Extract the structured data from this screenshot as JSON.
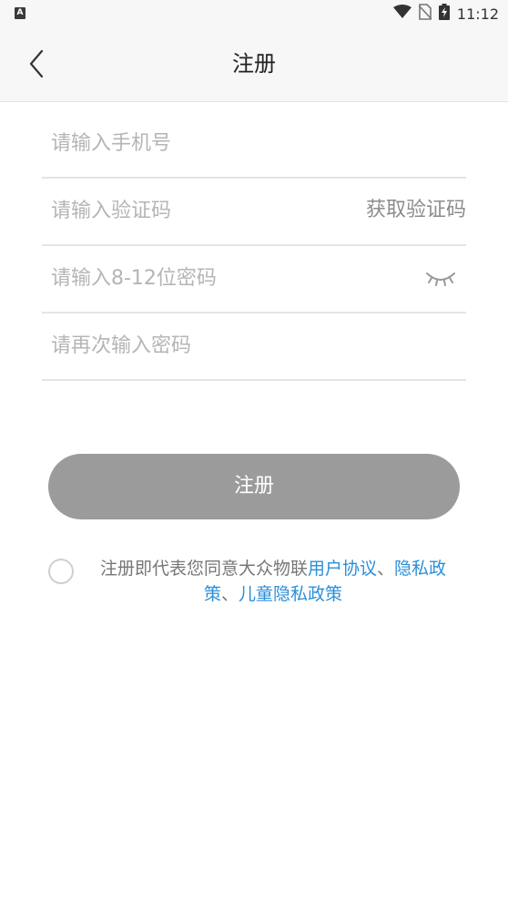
{
  "status_bar": {
    "app_icon_letter": "A",
    "time": "11:12"
  },
  "nav": {
    "title": "注册"
  },
  "form": {
    "phone_placeholder": "请输入手机号",
    "code_placeholder": "请输入验证码",
    "get_code_label": "获取验证码",
    "password_placeholder": "请输入8-12位密码",
    "confirm_password_placeholder": "请再次输入密码"
  },
  "register_button": {
    "label": "注册",
    "color": "#9b9b9b"
  },
  "agreement": {
    "prefix": "注册即代表您同意大众物联",
    "user_agreement": "用户协议",
    "sep1": "、",
    "privacy_policy": "隐私政策",
    "sep2": "、",
    "child_privacy_policy": "儿童隐私政策",
    "link_color": "#2a8fd8"
  }
}
